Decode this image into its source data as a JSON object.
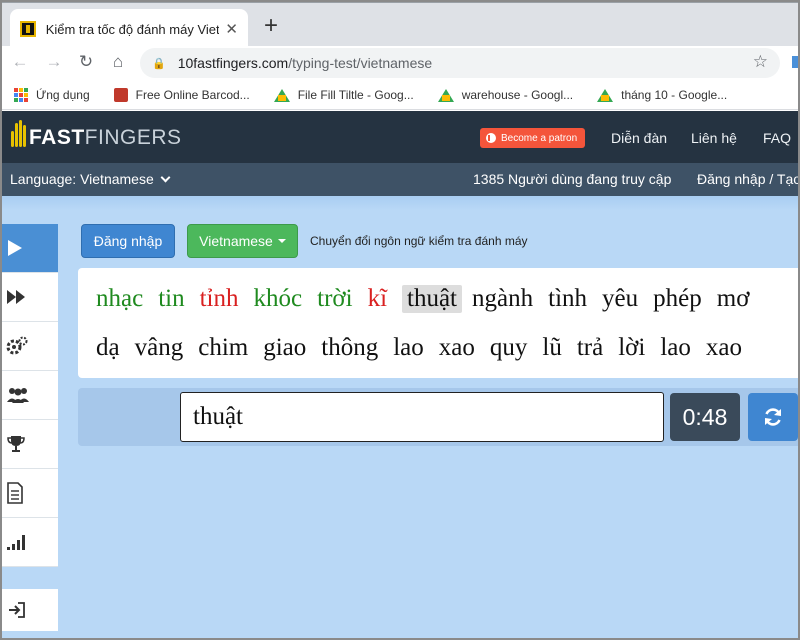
{
  "browser": {
    "tab_title": "Kiểm tra tốc độ đánh máy Vietna",
    "tab_close": "✕",
    "new_tab": "+",
    "url_host": "10fastfingers.com",
    "url_path": "/typing-test/vietnamese",
    "bookmarks": [
      {
        "label": "Ứng dụng",
        "icon": "apps-grid-icon"
      },
      {
        "label": "Free Online Barcod...",
        "icon": "barcode-icon"
      },
      {
        "label": "File Fill Tiltle - Goog...",
        "icon": "google-drive-icon"
      },
      {
        "label": "warehouse - Googl...",
        "icon": "google-drive-icon"
      },
      {
        "label": "tháng 10 - Google...",
        "icon": "google-drive-icon"
      }
    ]
  },
  "header": {
    "logo_main": "FAST",
    "logo_thin": "FINGERS",
    "patron_label": "Become a patron",
    "nav": [
      "Diễn đàn",
      "Liên hệ",
      "FAQ"
    ]
  },
  "subbar": {
    "language_label": "Language: Vietnamese",
    "online_count": "1385 Người dùng đang truy cập",
    "login_link": "Đăng nhập / Tạo"
  },
  "controls": {
    "login_button": "Đăng nhập",
    "language_button": "Vietnamese",
    "switch_text": "Chuyển đổi ngôn ngữ kiểm tra đánh máy"
  },
  "words": {
    "line1": [
      {
        "text": "nhạc",
        "state": "correct"
      },
      {
        "text": "tin",
        "state": "correct"
      },
      {
        "text": "tỉnh",
        "state": "wrong"
      },
      {
        "text": "khóc",
        "state": "correct"
      },
      {
        "text": "trời",
        "state": "correct"
      },
      {
        "text": "kĩ",
        "state": "wrong"
      },
      {
        "text": "thuật",
        "state": "current"
      },
      {
        "text": "ngành",
        "state": "pending"
      },
      {
        "text": "tình",
        "state": "pending"
      },
      {
        "text": "yêu",
        "state": "pending"
      },
      {
        "text": "phép",
        "state": "pending"
      },
      {
        "text": "mơ",
        "state": "pending"
      }
    ],
    "line2": [
      "dạ",
      "vâng",
      "chim",
      "giao",
      "thông",
      "lao",
      "xao",
      "quy",
      "lũ",
      "trả",
      "lời",
      "lao",
      "xao"
    ]
  },
  "typing": {
    "input_value": "thuật",
    "timer": "0:48"
  },
  "colors": {
    "correct": "#1f8a1f",
    "wrong": "#d92020",
    "header_bg": "#253341",
    "subbar_bg": "#3e5266",
    "accent_blue": "#3f86d1",
    "accent_green": "#4cb85c",
    "patron": "#f4553b"
  },
  "sidebar_icons": [
    "play-icon",
    "fast-forward-icon",
    "gears-icon",
    "users-icon",
    "trophy-icon",
    "document-icon",
    "signal-bars-icon",
    "logout-icon"
  ]
}
